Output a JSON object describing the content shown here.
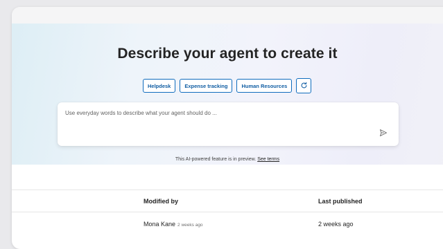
{
  "hero": {
    "title": "Describe your agent to create it",
    "chips": [
      "Helpdesk",
      "Expense tracking",
      "Human Resources"
    ],
    "refresh_icon": "refresh-icon"
  },
  "prompt": {
    "placeholder": "Use everyday words to describe what your agent should do ...",
    "send_icon": "send-icon"
  },
  "disclaimer": {
    "text": "This AI-powered feature is in preview.",
    "link": "See terms"
  },
  "table": {
    "columns": [
      "Modified by",
      "Last published"
    ],
    "rows": [
      {
        "modified_by": "Mona Kane",
        "modified_when": "2 weeks ago",
        "last_published": "2 weeks ago"
      }
    ]
  },
  "colors": {
    "accent": "#0f6cbd",
    "chip_text": "#115ea3"
  }
}
